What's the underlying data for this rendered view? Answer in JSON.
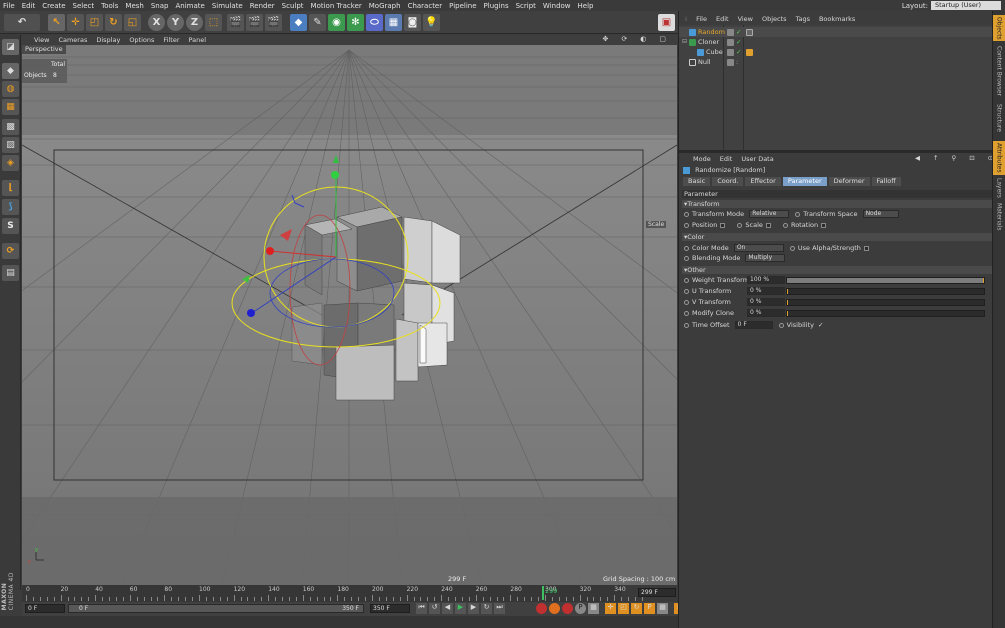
{
  "menu": [
    "File",
    "Edit",
    "Create",
    "Select",
    "Tools",
    "Mesh",
    "Snap",
    "Animate",
    "Simulate",
    "Render",
    "Sculpt",
    "Motion Tracker",
    "MoGraph",
    "Character",
    "Pipeline",
    "Plugins",
    "Script",
    "Window",
    "Help"
  ],
  "layout": {
    "label": "Layout:",
    "value": "Startup (User)"
  },
  "toolbar": {
    "x_axis": "X",
    "y_axis": "Y",
    "z_axis": "Z"
  },
  "viewport": {
    "menu": [
      "View",
      "Cameras",
      "Display",
      "Options",
      "Filter",
      "Panel"
    ],
    "label": "Perspective",
    "stats": {
      "total_label": "Total",
      "objects_label": "Objects",
      "objects_value": "8"
    },
    "frame_readout": "299 F",
    "grid_spacing": "Grid Spacing : 100 cm",
    "scale_label": "Scale"
  },
  "left_tools": {
    "spline_icon": "S"
  },
  "timeline": {
    "ticks": [
      "0",
      "20",
      "40",
      "60",
      "80",
      "100",
      "120",
      "140",
      "160",
      "180",
      "200",
      "220",
      "240",
      "260",
      "280",
      "300",
      "320",
      "340"
    ],
    "current": "299",
    "end_field": "299 F"
  },
  "transport": {
    "start": "0 F",
    "min": "0 F",
    "max": "350 F",
    "end": "350 F"
  },
  "brand": {
    "line1": "MAXON",
    "line2": "CINEMA 4D"
  },
  "objects": {
    "menu": [
      "File",
      "Edit",
      "View",
      "Objects",
      "Tags",
      "Bookmarks"
    ],
    "items": [
      {
        "name": "Random",
        "color": "#e6a82a"
      },
      {
        "name": "Cloner",
        "color": "#dddddd"
      },
      {
        "name": "Cube",
        "color": "#dddddd"
      },
      {
        "name": "Null",
        "color": "#dddddd"
      }
    ]
  },
  "attributes": {
    "menu": [
      "Mode",
      "Edit",
      "User Data"
    ],
    "header": "Randomize [Random]",
    "tabs": [
      "Basic",
      "Coord.",
      "Effector",
      "Parameter",
      "Deformer",
      "Falloff"
    ],
    "section": "Parameter",
    "transform": {
      "title": "Transform",
      "mode_label": "Transform Mode",
      "mode_value": "Relative",
      "space_label": "Transform Space",
      "space_value": "Node",
      "position": "Position",
      "scale": "Scale",
      "rotation": "Rotation"
    },
    "color": {
      "title": "Color",
      "mode_label": "Color Mode",
      "mode_value": "On",
      "alpha_label": "Use Alpha/Strength",
      "blend_label": "Blending Mode",
      "blend_value": "Multiply"
    },
    "other": {
      "title": "Other",
      "rows": [
        {
          "label": "Weight Transform",
          "value": "100 %",
          "level": 1.0
        },
        {
          "label": "U Transform",
          "value": "0 %",
          "level": 0.0
        },
        {
          "label": "V Transform",
          "value": "0 %",
          "level": 0.0
        },
        {
          "label": "Modify Clone",
          "value": "0 %",
          "level": 0.0
        }
      ],
      "time_offset_label": "Time Offset",
      "time_offset_value": "0 F",
      "visibility_label": "Visibility"
    }
  },
  "side_tabs": [
    "Objects",
    "Content Browser",
    "Structure",
    "Attributes",
    "Layers",
    "Materials"
  ]
}
